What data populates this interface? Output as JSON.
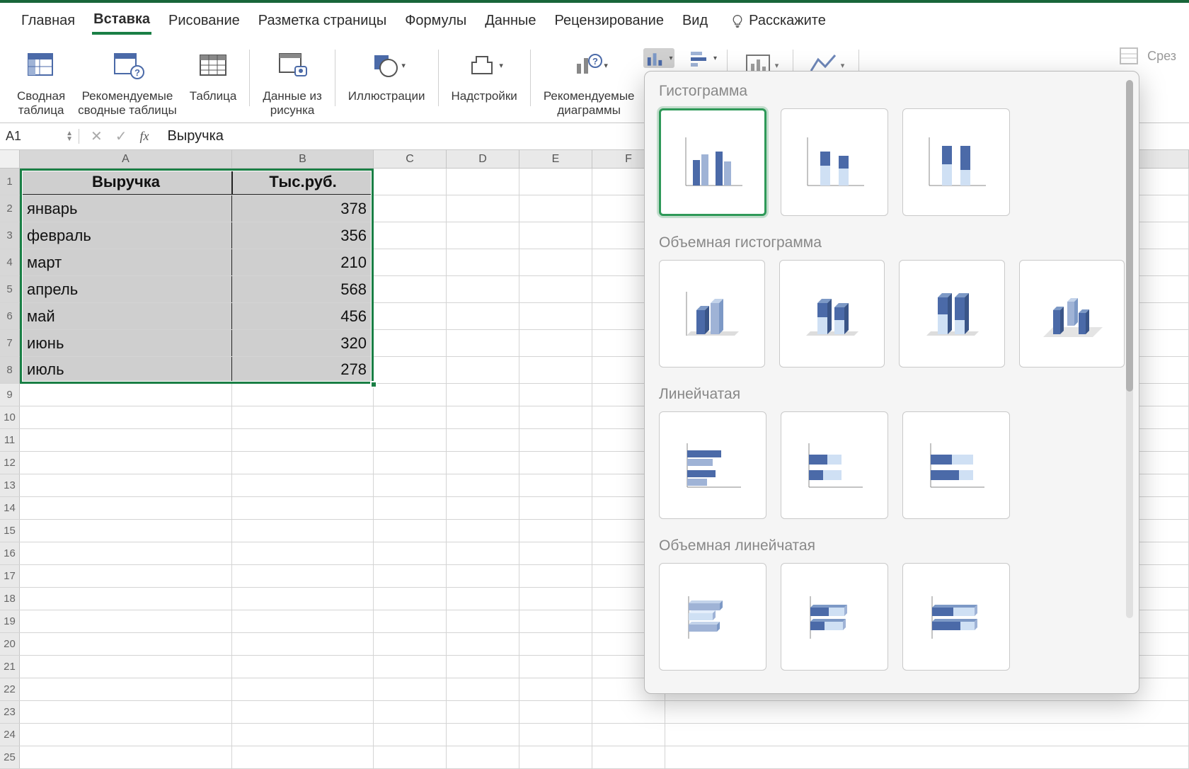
{
  "tabs": {
    "home": "Главная",
    "insert": "Вставка",
    "draw": "Рисование",
    "layout": "Разметка страницы",
    "formulas": "Формулы",
    "data": "Данные",
    "review": "Рецензирование",
    "view": "Вид",
    "tellme": "Расскажите"
  },
  "ribbon": {
    "pivot": "Сводная\nтаблица",
    "recpivot": "Рекомендуемые\nсводные таблицы",
    "table": "Таблица",
    "picdata": "Данные из\nрисунка",
    "illus": "Иллюстрации",
    "addins": "Надстройки",
    "reccharts": "Рекомендуемые\nдиаграммы",
    "slicer": "Срез"
  },
  "namebox": "A1",
  "formula": "Выручка",
  "columns": [
    "A",
    "B",
    "C",
    "D",
    "E",
    "F"
  ],
  "headers": {
    "a": "Выручка",
    "b": "Тыс.руб."
  },
  "rows": [
    {
      "n": "1"
    },
    {
      "n": "2",
      "a": "январь",
      "b": "378"
    },
    {
      "n": "3",
      "a": "февраль",
      "b": "356"
    },
    {
      "n": "4",
      "a": "март",
      "b": "210"
    },
    {
      "n": "5",
      "a": "апрель",
      "b": "568"
    },
    {
      "n": "6",
      "a": "май",
      "b": "456"
    },
    {
      "n": "7",
      "a": "июнь",
      "b": "320"
    },
    {
      "n": "8",
      "a": "июль",
      "b": "278"
    },
    {
      "n": "9"
    },
    {
      "n": "10"
    },
    {
      "n": "11"
    },
    {
      "n": "12"
    },
    {
      "n": "13"
    },
    {
      "n": "14"
    },
    {
      "n": "15"
    },
    {
      "n": "16"
    },
    {
      "n": "17"
    },
    {
      "n": "18"
    },
    {
      "n": "19"
    },
    {
      "n": "20"
    },
    {
      "n": "21"
    },
    {
      "n": "22"
    },
    {
      "n": "23"
    },
    {
      "n": "24"
    },
    {
      "n": "25"
    }
  ],
  "panel": {
    "s1": "Гистограмма",
    "s2": "Объемная гистограмма",
    "s3": "Линейчатая",
    "s4": "Объемная линейчатая"
  },
  "chart_data": {
    "type": "table",
    "title": "Выручка",
    "ylabel": "Тыс.руб.",
    "categories": [
      "январь",
      "февраль",
      "март",
      "апрель",
      "май",
      "июнь",
      "июль"
    ],
    "values": [
      378,
      356,
      210,
      568,
      456,
      320,
      278
    ]
  }
}
